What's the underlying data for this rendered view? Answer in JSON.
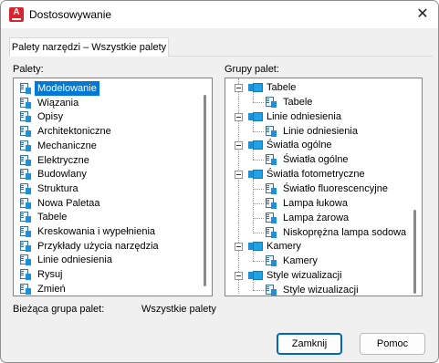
{
  "window": {
    "title": "Dostosowywanie",
    "close_symbol": "✕"
  },
  "app_icon": {
    "letter": "A",
    "color": "#d9232e"
  },
  "tabs": [
    {
      "label": "Palety narzędzi – Wszystkie palety",
      "active": true
    }
  ],
  "palettes": {
    "label": "Palety:",
    "items": [
      {
        "label": "Modelowanie",
        "selected": true
      },
      {
        "label": "Wiązania"
      },
      {
        "label": "Opisy"
      },
      {
        "label": "Architektoniczne"
      },
      {
        "label": "Mechaniczne"
      },
      {
        "label": "Elektryczne"
      },
      {
        "label": "Budowlany"
      },
      {
        "label": "Struktura"
      },
      {
        "label": "Nowa Paletaa"
      },
      {
        "label": "Tabele"
      },
      {
        "label": "Kreskowania i wypełnienia"
      },
      {
        "label": "Przykłady użycia narzędzia"
      },
      {
        "label": "Linie odniesienia"
      },
      {
        "label": "Rysuj"
      },
      {
        "label": "Zmień"
      }
    ]
  },
  "groups": {
    "label": "Grupy palet:",
    "tree": [
      {
        "label": "Tabele",
        "children": [
          "Tabele"
        ]
      },
      {
        "label": "Linie odniesienia",
        "children": [
          "Linie odniesienia"
        ]
      },
      {
        "label": "Światła ogólne",
        "children": [
          "Światła ogólne"
        ]
      },
      {
        "label": "Światła fotometryczne",
        "children": [
          "Światło fluorescencyjne",
          "Lampa łukowa",
          "Lampa żarowa",
          "Niskoprężna lampa sodowa"
        ]
      },
      {
        "label": "Kamery",
        "children": [
          "Kamery"
        ]
      },
      {
        "label": "Style wizualizacji",
        "children": [
          "Style wizualizacji"
        ]
      }
    ]
  },
  "current_group": {
    "label": "Bieżąca grupa palet:",
    "value": "Wszystkie palety"
  },
  "buttons": {
    "close": "Zamknij",
    "help": "Pomoc"
  },
  "colors": {
    "selection": "#0078d7",
    "default_button_border": "#0067c0"
  }
}
